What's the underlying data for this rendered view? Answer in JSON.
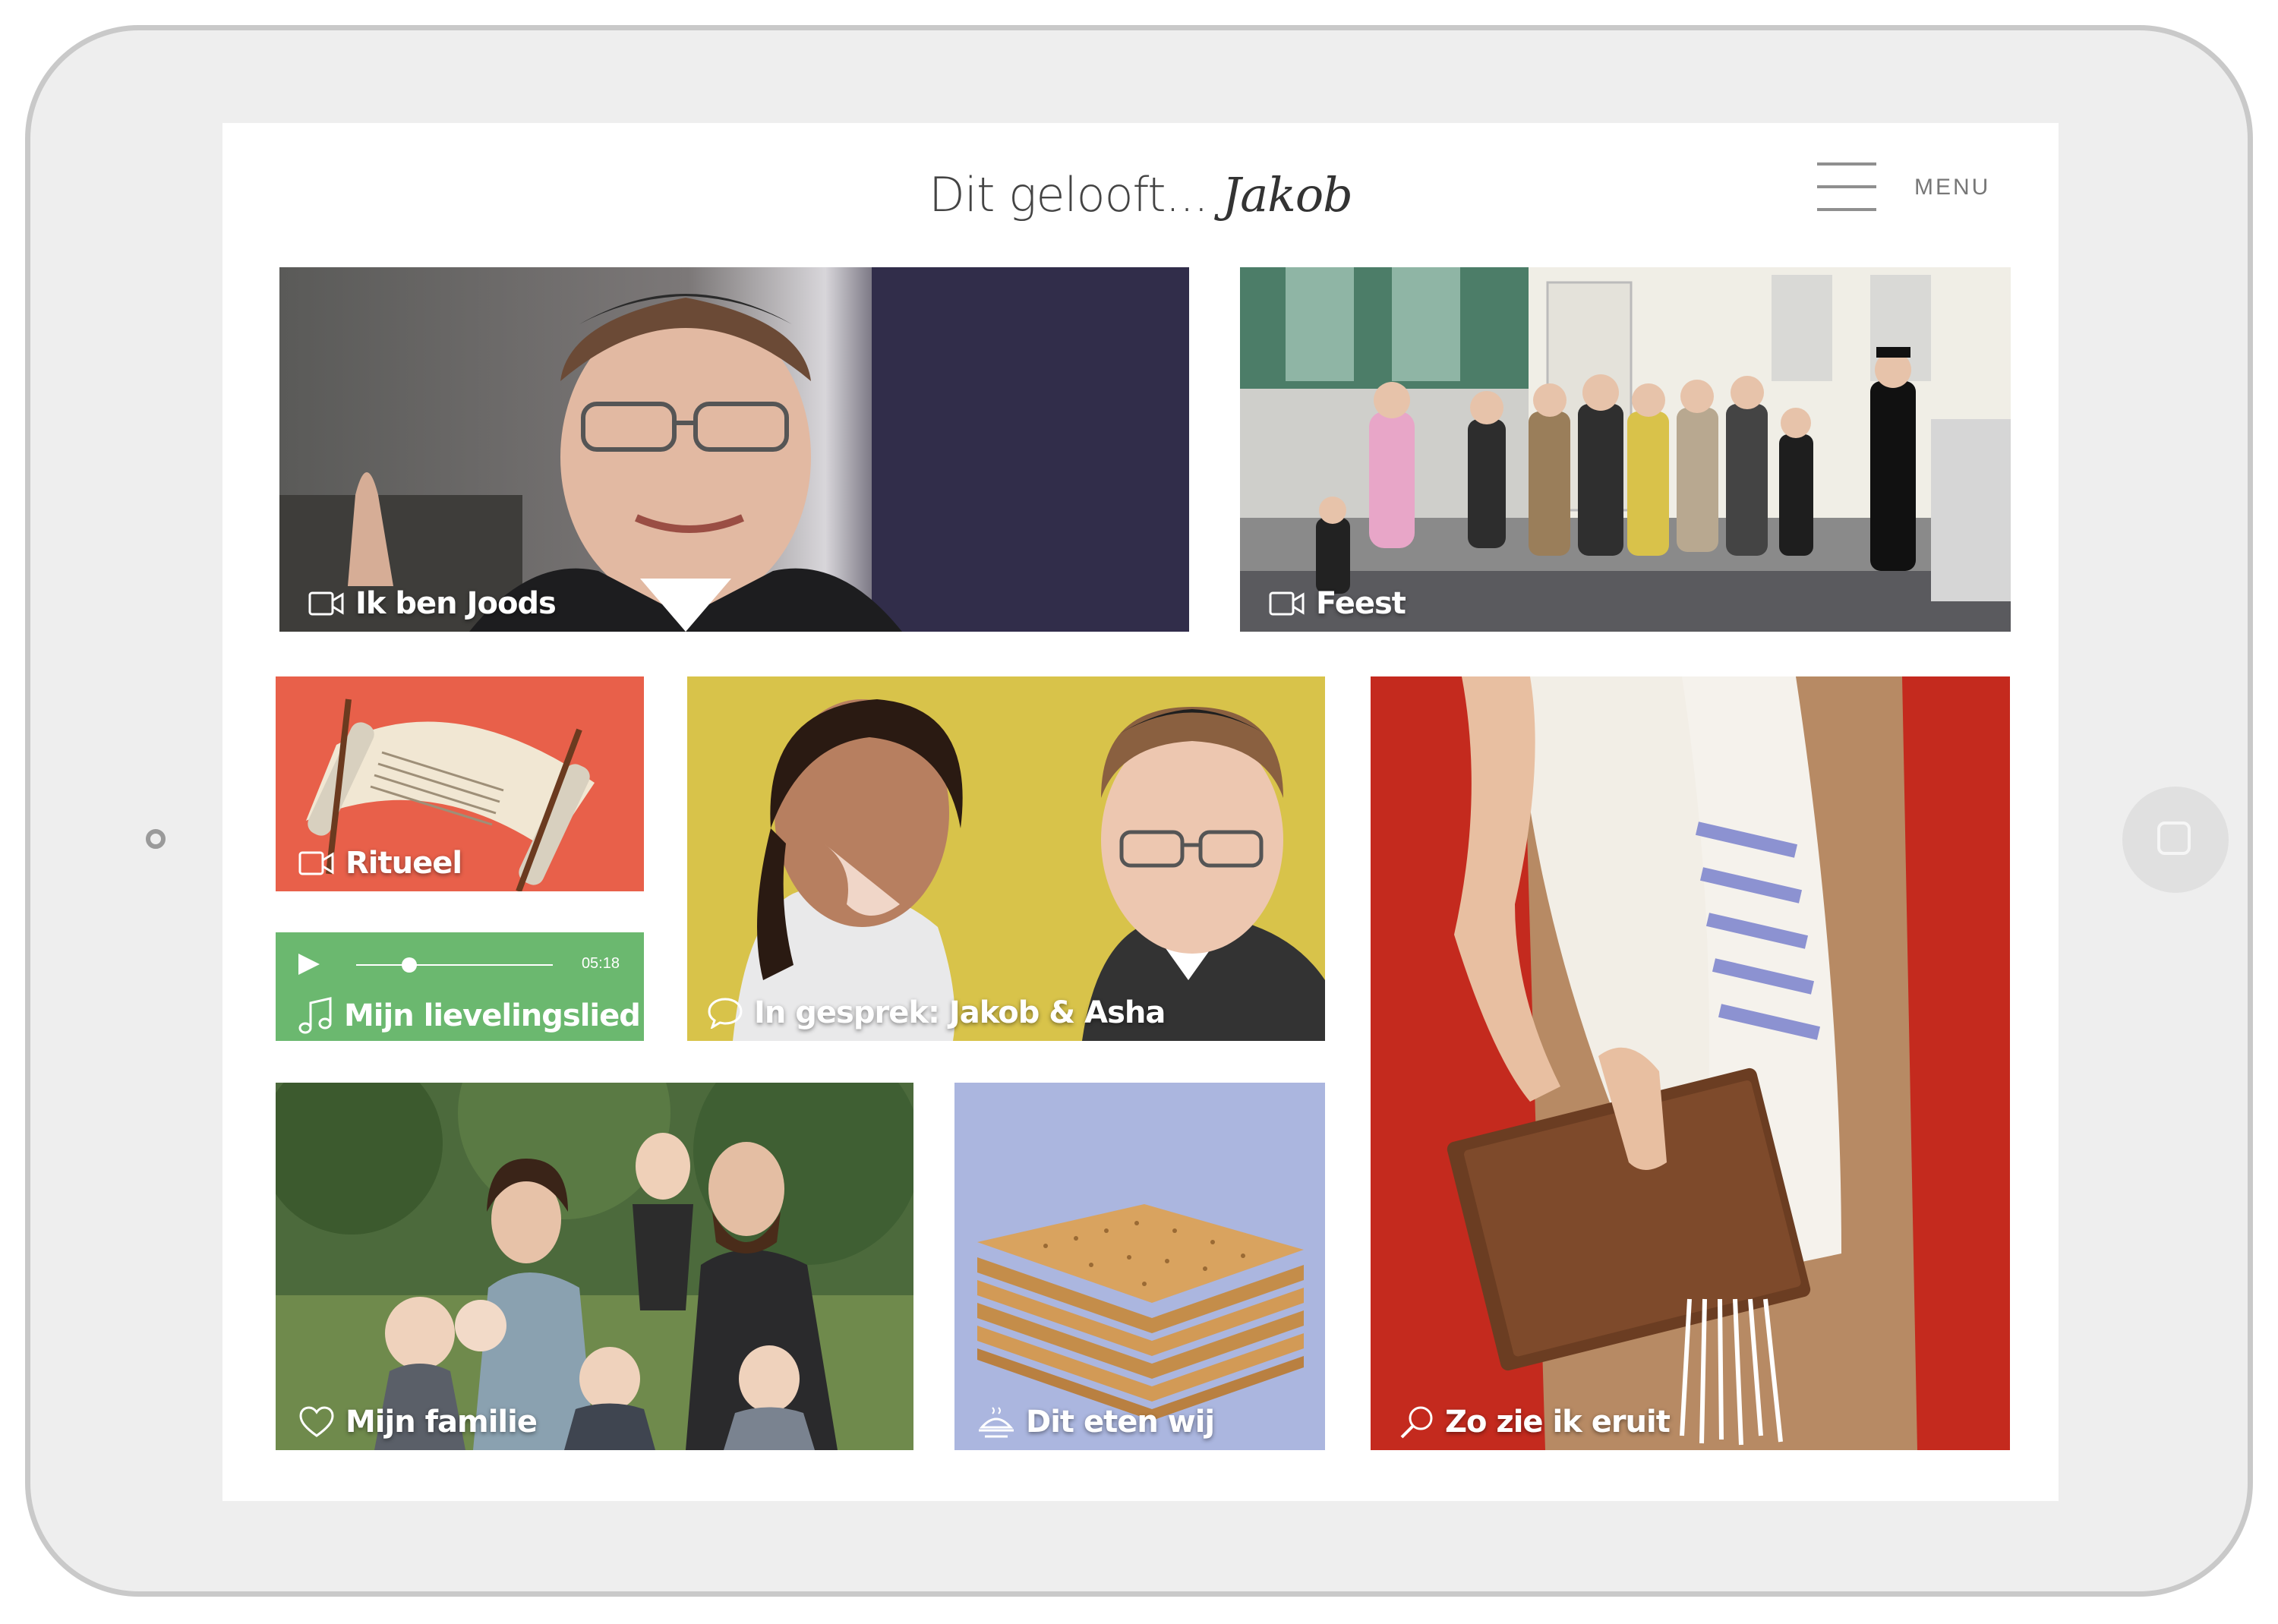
{
  "header": {
    "title_prefix": "Dit gelooft...",
    "title_name": "Jakob",
    "menu_label": "MENU"
  },
  "tiles": {
    "ik_ben_joods": {
      "label": "Ik ben Joods",
      "icon": "video-camera-icon"
    },
    "feest": {
      "label": "Feest",
      "icon": "video-camera-icon"
    },
    "ritueel": {
      "label": "Ritueel",
      "icon": "video-camera-icon"
    },
    "lievelingslied": {
      "label": "Mijn lievelingslied",
      "icon": "music-note-icon",
      "duration": "05:18",
      "progress": 0.27
    },
    "in_gesprek": {
      "label": "In gesprek: Jakob & Asha",
      "icon": "speech-bubble-icon"
    },
    "zo_zie_ik_eruit": {
      "label": "Zo zie ik eruit",
      "icon": "magnifier-icon"
    },
    "mijn_familie": {
      "label": "Mijn familie",
      "icon": "heart-icon"
    },
    "dit_eten_wij": {
      "label": "Dit eten wij",
      "icon": "food-dish-icon"
    }
  },
  "colors": {
    "ritueel_bg": "#e8604a",
    "lievelingslied_bg": "#6bb86f",
    "in_gesprek_bg": "#d8c34a",
    "zo_zie_ik_eruit_bg": "#c42a1e",
    "dit_eten_wij_bg": "#abb6df"
  }
}
